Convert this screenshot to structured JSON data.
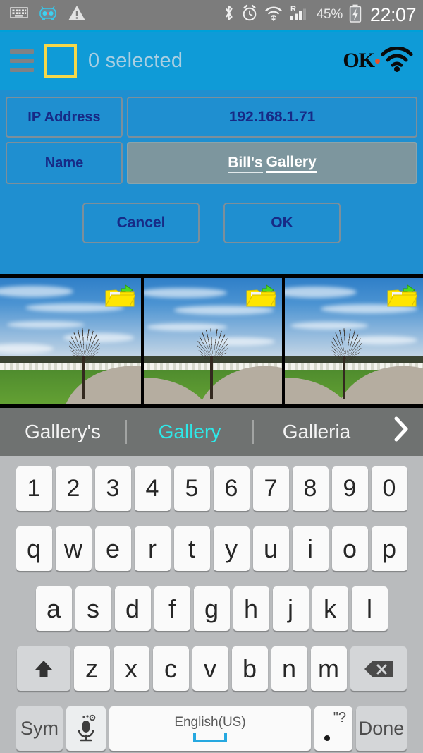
{
  "status_bar": {
    "left_icons": [
      "keyboard-icon",
      "robot-app-icon",
      "warning-icon"
    ],
    "right_icons": [
      "bluetooth-icon",
      "alarm-icon",
      "wifi-icon",
      "roaming-signal-icon"
    ],
    "battery_percent": "45%",
    "battery_icon": "battery-charging-icon",
    "clock": "22:07",
    "background": "#7c7c7c"
  },
  "app_header": {
    "menu_icon": "hamburger-icon",
    "select_all_checkbox": "checkbox-unchecked-icon",
    "title": "0 selected",
    "logo_text": "OK",
    "logo_wifi_icon": "wifi-icon",
    "background": "#0f9bd7",
    "title_color": "#a9cfe2",
    "checkbox_color": "#f5d84a"
  },
  "dialog": {
    "background": "#1f8fd0",
    "fields": [
      {
        "label": "IP Address",
        "value": "192.168.1.71",
        "focused": false
      },
      {
        "label": "Name",
        "value": "Bill's Gallery",
        "value_part_1": "Bill's",
        "value_part_2": "Gallery",
        "focused": true
      }
    ],
    "buttons": [
      {
        "label": "Cancel",
        "name": "cancel-button"
      },
      {
        "label": "OK",
        "name": "ok-button"
      }
    ],
    "label_text_color": "#172a86",
    "focused_field_background": "#7d969e"
  },
  "thumbnail_strip": {
    "background": "#000000",
    "items": [
      {
        "alt": "park-landscape-photo-1",
        "badge_icon": "folder-upload-icon"
      },
      {
        "alt": "park-landscape-photo-2",
        "badge_icon": "folder-upload-icon"
      },
      {
        "alt": "park-landscape-photo-3",
        "badge_icon": "folder-upload-icon"
      }
    ]
  },
  "suggestion_bar": {
    "background": "#6f7271",
    "active_color": "#2ee8e8",
    "suggestions": [
      {
        "text": "Gallery's",
        "active": false
      },
      {
        "text": "Gallery",
        "active": true
      },
      {
        "text": "Galleria",
        "active": false
      }
    ],
    "expand_icon": "chevron-right-icon"
  },
  "keyboard": {
    "background": "#b9bbbd",
    "rows": {
      "numbers": [
        "1",
        "2",
        "3",
        "4",
        "5",
        "6",
        "7",
        "8",
        "9",
        "0"
      ],
      "top": [
        "q",
        "w",
        "e",
        "r",
        "t",
        "y",
        "u",
        "i",
        "o",
        "p"
      ],
      "home": [
        "a",
        "s",
        "d",
        "f",
        "g",
        "h",
        "j",
        "k",
        "l"
      ],
      "bottom": [
        "z",
        "x",
        "c",
        "v",
        "b",
        "n",
        "m"
      ]
    },
    "shift_key": {
      "label": "",
      "icon": "shift-arrow-up-icon"
    },
    "backspace_key": {
      "label": "",
      "icon": "backspace-icon"
    },
    "sym_key": {
      "label": "Sym"
    },
    "mic_key": {
      "label": "",
      "icon": "microphone-settings-icon"
    },
    "space_key": {
      "label": "English(US)",
      "icon": "space-bar-icon"
    },
    "period_key": {
      "label": ".",
      "secondary": "\"?"
    },
    "done_key": {
      "label": "Done"
    }
  }
}
